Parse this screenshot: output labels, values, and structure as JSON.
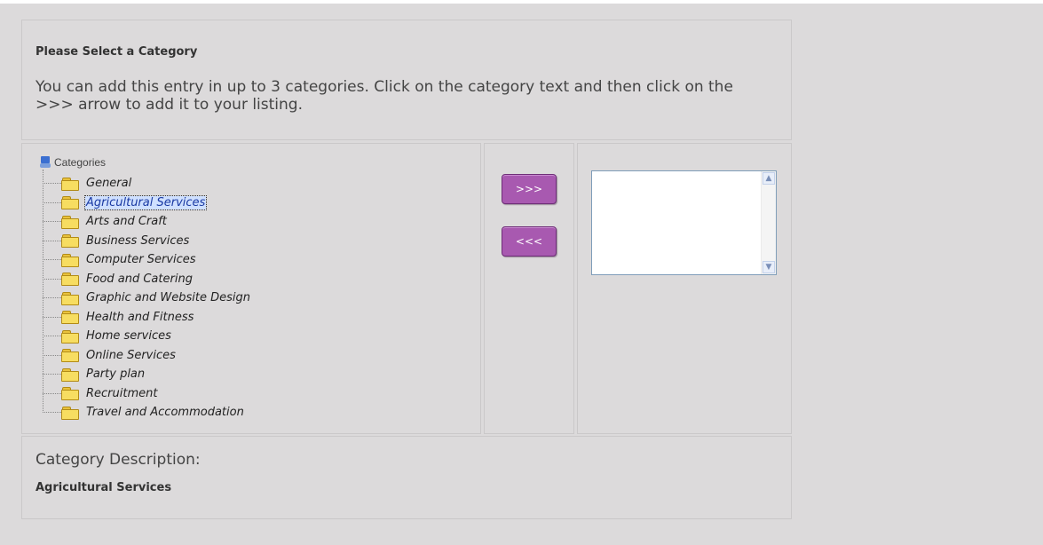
{
  "header": {
    "heading": "Please Select a Category",
    "instructions": "You can add this entry in up to 3 categories. Click on the category text and then click on the >>> arrow to add it to your listing."
  },
  "tree": {
    "root_label": "Categories",
    "root_icon": "computer-icon",
    "item_icon": "folder-icon",
    "selected_index": 1,
    "items": [
      "General",
      "Agricultural Services",
      "Arts and Craft",
      "Business Services",
      "Computer Services",
      "Food and Catering",
      "Graphic and Website Design",
      "Health and Fitness",
      "Home services",
      "Online Services",
      "Party plan",
      "Recruitment",
      "Travel and Accommodation"
    ]
  },
  "buttons": {
    "add_label": ">>>",
    "remove_label": "<<<"
  },
  "selected_list": {
    "items": []
  },
  "description": {
    "label": "Category Description:",
    "value": "Agricultural Services"
  },
  "colors": {
    "background": "#dcdadb",
    "button": "#a859b0",
    "selection": "#cfe0ff"
  }
}
